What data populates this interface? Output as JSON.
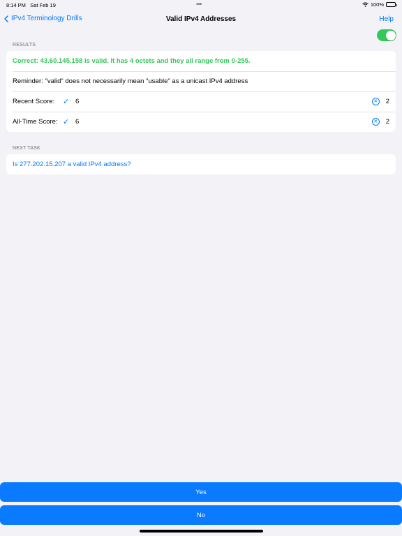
{
  "status": {
    "time": "8:14 PM",
    "date": "Sat Feb 19",
    "battery": "100%"
  },
  "nav": {
    "back_label": "IPv4 Terminology Drills",
    "title": "Valid IPv4 Addresses",
    "help_label": "Help"
  },
  "toggle": {
    "on": true,
    "color": "#34c759"
  },
  "results": {
    "header": "RESULTS",
    "correct_message": "Correct: 43.60.145.158 is valid.  It has 4 octets and they all range from 0-255.",
    "reminder": "Reminder: \"valid\" does not necessarily mean \"usable\" as a unicast IPv4 address",
    "recent": {
      "label": "Recent Score:",
      "correct": "6",
      "wrong": "2"
    },
    "alltime": {
      "label": "All-Time Score:",
      "correct": "6",
      "wrong": "2"
    }
  },
  "next_task": {
    "header": "NEXT TASK",
    "question": "Is 277.202.15.207 a valid IPv4 address?"
  },
  "buttons": {
    "yes": "Yes",
    "no": "No"
  },
  "colors": {
    "accent": "#007aff",
    "success": "#34c759",
    "button": "#0a7aff",
    "background": "#f2f2f7"
  }
}
